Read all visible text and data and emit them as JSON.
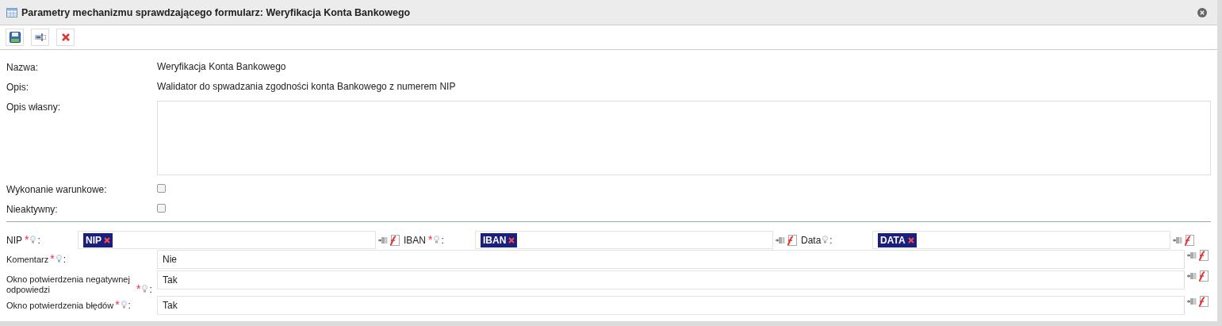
{
  "window": {
    "title": "Parametry mechanizmu sprawdzającego formularz: Weryfikacja Konta Bankowego"
  },
  "toolbar": [
    {
      "kind": "save"
    },
    {
      "kind": "rename"
    },
    {
      "kind": "delete"
    }
  ],
  "properties": [
    {
      "kind": "text",
      "label": "Nazwa:",
      "value": "Weryfikacja Konta Bankowego"
    },
    {
      "kind": "text",
      "label": "Opis:",
      "value": "Walidator do spwadzania zgodności konta Bankowego z numerem NIP"
    },
    {
      "kind": "textarea",
      "label": "Opis własny:"
    },
    {
      "kind": "checkbox",
      "label": "Wykonanie warunkowe:",
      "checked": false
    },
    {
      "kind": "checkbox",
      "label": "Nieaktywny:",
      "checked": false
    }
  ],
  "parameters": {
    "inline": [
      {
        "label": "NIP",
        "mark": "*",
        "suffix": ":",
        "tag": "NIP"
      },
      {
        "label": "IBAN",
        "mark": "*",
        "suffix": ":",
        "tag": "IBAN"
      },
      {
        "label": "Data",
        "suffix": ":",
        "tag": "DATA"
      }
    ],
    "rows": [
      {
        "label": "Komentarz",
        "mark": "*",
        "suffix": ":",
        "value": "Nie"
      },
      {
        "label": "Okno potwierdzenia negatywnej odpowiedzi",
        "mark": "*",
        "suffix": ":",
        "value": "Tak"
      },
      {
        "label": "Okno potwierdzenia błędów",
        "mark": "*",
        "suffix": ":",
        "value": "Tak"
      }
    ]
  }
}
